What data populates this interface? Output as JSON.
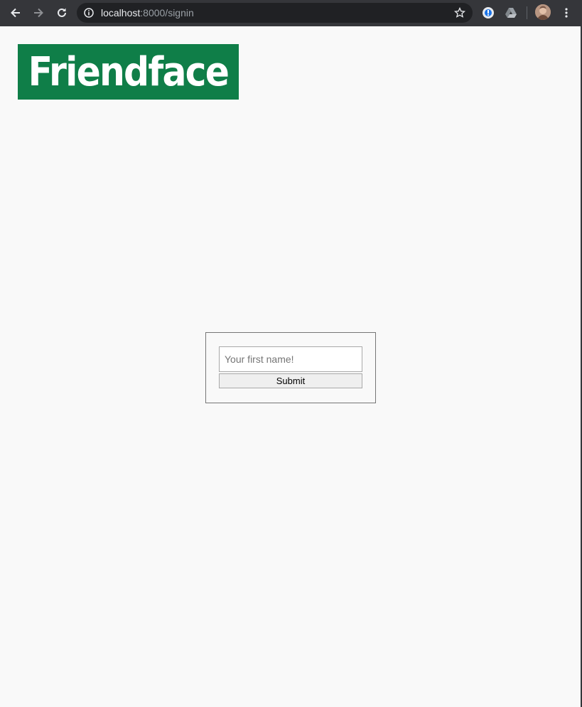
{
  "browser": {
    "url_host": "localhost",
    "url_path": ":8000/signin",
    "icons": {
      "back": "arrow-left-icon",
      "forward": "arrow-right-icon",
      "reload": "reload-icon",
      "info": "info-icon",
      "bookmark": "star-icon",
      "extension_1": "password-extension-icon",
      "extension_2": "drive-icon",
      "profile": "avatar",
      "menu": "kebab-menu-icon"
    }
  },
  "page": {
    "logo_text": "Friendface",
    "brand_color": "#0f7e48",
    "form": {
      "name_placeholder": "Your first name!",
      "name_value": "",
      "submit_label": "Submit"
    }
  }
}
